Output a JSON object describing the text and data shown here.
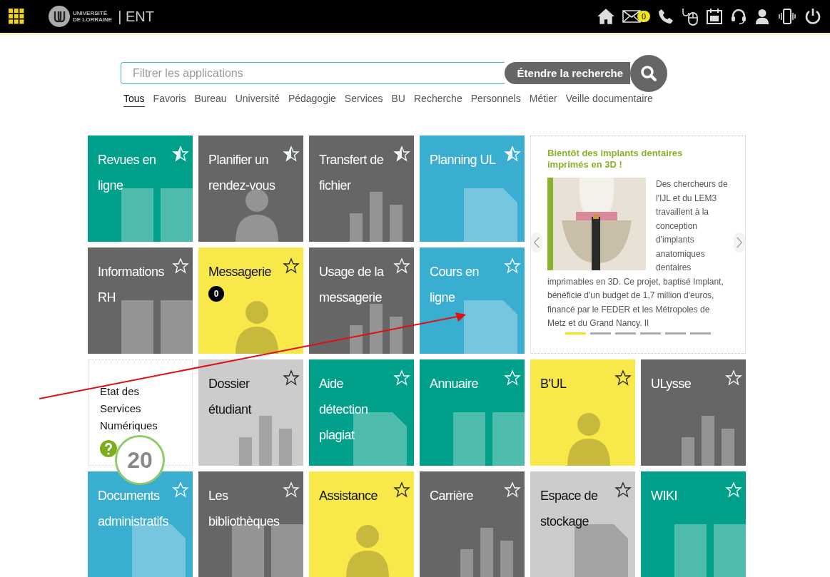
{
  "header": {
    "logo_line_1": "UNIVERSITÉ",
    "logo_line_2": "DE LORRAINE",
    "app_name": "| ENT",
    "mail_count": "0"
  },
  "search": {
    "placeholder": "Filtrer les applications",
    "button": "Étendre la recherche"
  },
  "tabs": [
    {
      "label": "Tous",
      "selected": true
    },
    {
      "label": "Favoris",
      "selected": false
    },
    {
      "label": "Bureau",
      "selected": false
    },
    {
      "label": "Université",
      "selected": false
    },
    {
      "label": "Pédagogie",
      "selected": false
    },
    {
      "label": "Services",
      "selected": false
    },
    {
      "label": "BU",
      "selected": false
    },
    {
      "label": "Recherche",
      "selected": false
    },
    {
      "label": "Personnels",
      "selected": false
    },
    {
      "label": "Métier",
      "selected": false
    },
    {
      "label": "Veille documentaire",
      "selected": false
    }
  ],
  "tiles_top": [
    {
      "name": "Revues en ligne",
      "color": "#00a08a",
      "favorite": true
    },
    {
      "name": "Planifier un rendez-vous",
      "color": "#666666",
      "favorite": true
    },
    {
      "name": "Transfert de fichier",
      "color": "#666666",
      "favorite": true
    },
    {
      "name": "Planning UL",
      "color": "#3aaed0",
      "favorite": true
    },
    {
      "name": "Informations RH",
      "color": "#666666",
      "favorite": false
    },
    {
      "name": "Messagerie",
      "color": "#f9e84a",
      "favorite": false,
      "badge": "0"
    },
    {
      "name": "Usage de la messagerie",
      "color": "#666666",
      "favorite": false
    },
    {
      "name": "Cours en ligne",
      "color": "#3aaed0",
      "favorite": false
    }
  ],
  "news": {
    "title": "Bientôt des implants dentaires imprimés en 3D !",
    "text_beside": "Des chercheurs de l'IJL et du LEM3 travaillent à la conception d'implants anatomiques dentaires",
    "text_below": "imprimables en 3D. Ce projet, baptisé Implant, bénéficie d'un budget de 1,7 million d'euros, financé par le FEDER et les Métropoles de Metz et du Grand Nancy. Il",
    "slides": [
      {
        "selected": true
      },
      {
        "selected": false
      },
      {
        "selected": false
      },
      {
        "selected": false
      },
      {
        "selected": false
      },
      {
        "selected": false
      }
    ]
  },
  "status_card": {
    "text": "État des Services Numériques"
  },
  "tiles_bottom": [
    {
      "name": "Dossier étudiant",
      "color": "#cccccc",
      "favorite": false
    },
    {
      "name": "Aide détection plagiat",
      "color": "#00a08a",
      "favorite": false
    },
    {
      "name": "Annuaire",
      "color": "#00a08a",
      "favorite": false
    },
    {
      "name": "B'UL",
      "color": "#f9e84a",
      "favorite": false
    },
    {
      "name": "ULysse",
      "color": "#666666",
      "favorite": false
    },
    {
      "name": "Documents administratifs",
      "color": "#3aaed0",
      "favorite": false
    },
    {
      "name": "Les bibliothèques",
      "color": "#666666",
      "favorite": false
    },
    {
      "name": "Assistance",
      "color": "#f9e84a",
      "favorite": false
    },
    {
      "name": "Carrière",
      "color": "#666666",
      "favorite": false
    },
    {
      "name": "Espace de stockage",
      "color": "#cccccc",
      "favorite": false
    },
    {
      "name": "WIKI",
      "color": "#00a08a",
      "favorite": false
    }
  ],
  "annotation": {
    "step": "20"
  }
}
